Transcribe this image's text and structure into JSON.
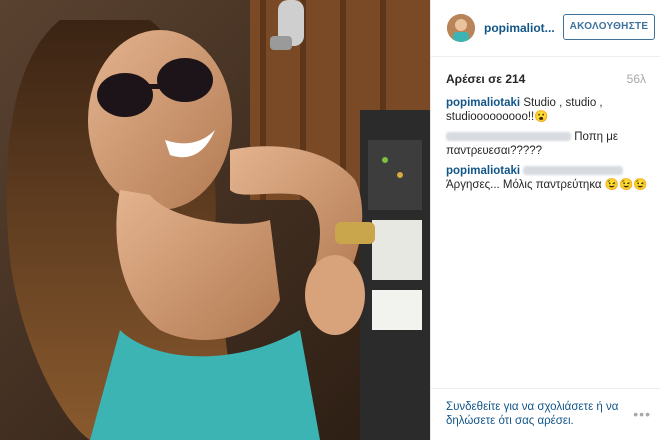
{
  "header": {
    "username": "popimaliot...",
    "follow_label": "ΑΚΟΛΟΥΘΗΣΤΕ",
    "avatar_icon": "profile-avatar"
  },
  "stats": {
    "likes": "Αρέσει σε 214",
    "time": "56λ"
  },
  "comments": [
    {
      "user": "popimaliotaki",
      "text": "Studio , studio , studiooooooooo!!😮"
    },
    {
      "user": "",
      "text": "Ποπη με παντρευεσαι?????"
    },
    {
      "user": "popimaliotaki",
      "text": "Άργησες... Μόλις παντρεύτηκα 😉😉😉"
    }
  ],
  "footer": {
    "login_prompt": "Συνδεθείτε για να σχολιάσετε ή να δηλώσετε ότι σας αρέσει.",
    "more_icon": "more-options-icon",
    "more_glyph": "•••"
  },
  "colors": {
    "link": "#125688",
    "follow_border": "#3f729b",
    "muted": "#a5a7aa"
  }
}
